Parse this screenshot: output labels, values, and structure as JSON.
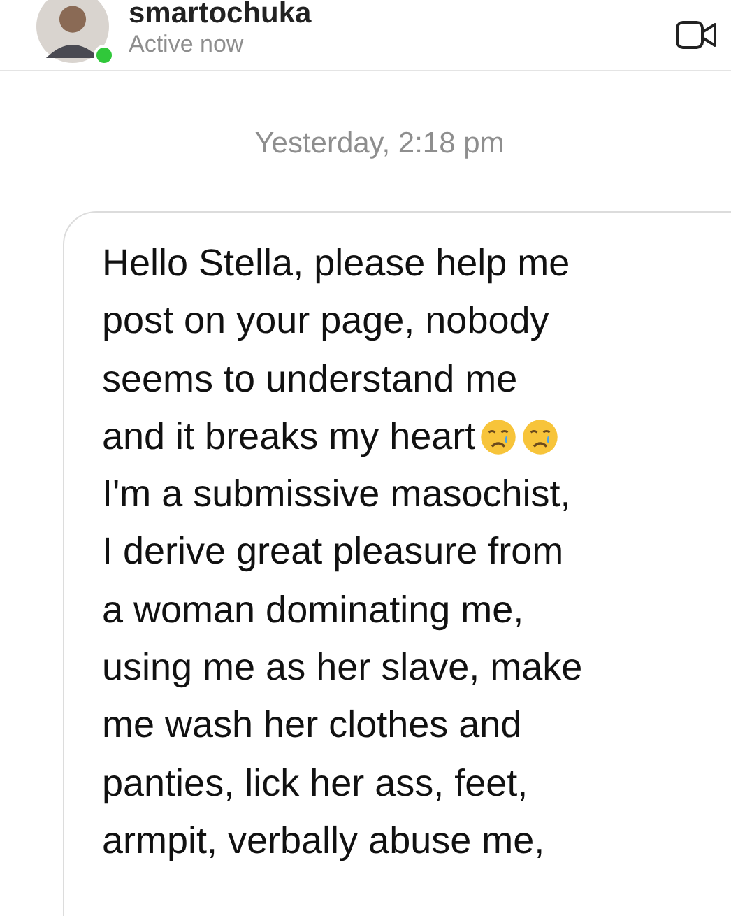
{
  "header": {
    "username": "smartochuka",
    "status": "Active now",
    "online": true
  },
  "timestamp": "Yesterday, 2:18 pm",
  "message": {
    "lines": [
      [
        {
          "kind": "text",
          "text": "Hello Stella, please help me"
        }
      ],
      [
        {
          "kind": "text",
          "text": "post on your page, nobody"
        }
      ],
      [
        {
          "kind": "text",
          "text": "seems to understand me"
        }
      ],
      [
        {
          "kind": "text",
          "text": "and it breaks my heart"
        },
        {
          "kind": "emoji"
        },
        {
          "kind": "emoji"
        }
      ],
      [
        {
          "kind": "text",
          "text": "I'm a submissive masochist,"
        }
      ],
      [
        {
          "kind": "text",
          "text": "I derive great pleasure from"
        }
      ],
      [
        {
          "kind": "text",
          "text": "a woman dominating me,"
        }
      ],
      [
        {
          "kind": "text",
          "text": "using me as her slave, make"
        }
      ],
      [
        {
          "kind": "text",
          "text": "me wash her clothes and"
        }
      ],
      [
        {
          "kind": "text",
          "text": "panties, lick her ass, feet,"
        }
      ],
      [
        {
          "kind": "text",
          "text": "armpit, verbally abuse me,"
        }
      ]
    ]
  }
}
